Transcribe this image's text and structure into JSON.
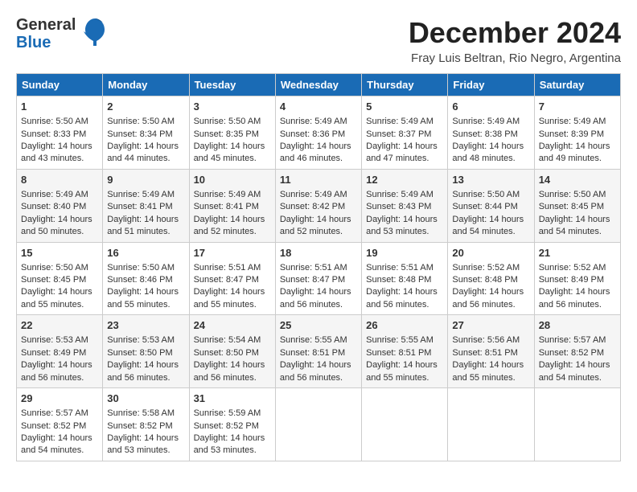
{
  "logo": {
    "line1": "General",
    "line2": "Blue"
  },
  "title": "December 2024",
  "location": "Fray Luis Beltran, Rio Negro, Argentina",
  "days_header": [
    "Sunday",
    "Monday",
    "Tuesday",
    "Wednesday",
    "Thursday",
    "Friday",
    "Saturday"
  ],
  "weeks": [
    [
      {
        "day": "1",
        "sunrise": "Sunrise: 5:50 AM",
        "sunset": "Sunset: 8:33 PM",
        "daylight": "Daylight: 14 hours and 43 minutes."
      },
      {
        "day": "2",
        "sunrise": "Sunrise: 5:50 AM",
        "sunset": "Sunset: 8:34 PM",
        "daylight": "Daylight: 14 hours and 44 minutes."
      },
      {
        "day": "3",
        "sunrise": "Sunrise: 5:50 AM",
        "sunset": "Sunset: 8:35 PM",
        "daylight": "Daylight: 14 hours and 45 minutes."
      },
      {
        "day": "4",
        "sunrise": "Sunrise: 5:49 AM",
        "sunset": "Sunset: 8:36 PM",
        "daylight": "Daylight: 14 hours and 46 minutes."
      },
      {
        "day": "5",
        "sunrise": "Sunrise: 5:49 AM",
        "sunset": "Sunset: 8:37 PM",
        "daylight": "Daylight: 14 hours and 47 minutes."
      },
      {
        "day": "6",
        "sunrise": "Sunrise: 5:49 AM",
        "sunset": "Sunset: 8:38 PM",
        "daylight": "Daylight: 14 hours and 48 minutes."
      },
      {
        "day": "7",
        "sunrise": "Sunrise: 5:49 AM",
        "sunset": "Sunset: 8:39 PM",
        "daylight": "Daylight: 14 hours and 49 minutes."
      }
    ],
    [
      {
        "day": "8",
        "sunrise": "Sunrise: 5:49 AM",
        "sunset": "Sunset: 8:40 PM",
        "daylight": "Daylight: 14 hours and 50 minutes."
      },
      {
        "day": "9",
        "sunrise": "Sunrise: 5:49 AM",
        "sunset": "Sunset: 8:41 PM",
        "daylight": "Daylight: 14 hours and 51 minutes."
      },
      {
        "day": "10",
        "sunrise": "Sunrise: 5:49 AM",
        "sunset": "Sunset: 8:41 PM",
        "daylight": "Daylight: 14 hours and 52 minutes."
      },
      {
        "day": "11",
        "sunrise": "Sunrise: 5:49 AM",
        "sunset": "Sunset: 8:42 PM",
        "daylight": "Daylight: 14 hours and 52 minutes."
      },
      {
        "day": "12",
        "sunrise": "Sunrise: 5:49 AM",
        "sunset": "Sunset: 8:43 PM",
        "daylight": "Daylight: 14 hours and 53 minutes."
      },
      {
        "day": "13",
        "sunrise": "Sunrise: 5:50 AM",
        "sunset": "Sunset: 8:44 PM",
        "daylight": "Daylight: 14 hours and 54 minutes."
      },
      {
        "day": "14",
        "sunrise": "Sunrise: 5:50 AM",
        "sunset": "Sunset: 8:45 PM",
        "daylight": "Daylight: 14 hours and 54 minutes."
      }
    ],
    [
      {
        "day": "15",
        "sunrise": "Sunrise: 5:50 AM",
        "sunset": "Sunset: 8:45 PM",
        "daylight": "Daylight: 14 hours and 55 minutes."
      },
      {
        "day": "16",
        "sunrise": "Sunrise: 5:50 AM",
        "sunset": "Sunset: 8:46 PM",
        "daylight": "Daylight: 14 hours and 55 minutes."
      },
      {
        "day": "17",
        "sunrise": "Sunrise: 5:51 AM",
        "sunset": "Sunset: 8:47 PM",
        "daylight": "Daylight: 14 hours and 55 minutes."
      },
      {
        "day": "18",
        "sunrise": "Sunrise: 5:51 AM",
        "sunset": "Sunset: 8:47 PM",
        "daylight": "Daylight: 14 hours and 56 minutes."
      },
      {
        "day": "19",
        "sunrise": "Sunrise: 5:51 AM",
        "sunset": "Sunset: 8:48 PM",
        "daylight": "Daylight: 14 hours and 56 minutes."
      },
      {
        "day": "20",
        "sunrise": "Sunrise: 5:52 AM",
        "sunset": "Sunset: 8:48 PM",
        "daylight": "Daylight: 14 hours and 56 minutes."
      },
      {
        "day": "21",
        "sunrise": "Sunrise: 5:52 AM",
        "sunset": "Sunset: 8:49 PM",
        "daylight": "Daylight: 14 hours and 56 minutes."
      }
    ],
    [
      {
        "day": "22",
        "sunrise": "Sunrise: 5:53 AM",
        "sunset": "Sunset: 8:49 PM",
        "daylight": "Daylight: 14 hours and 56 minutes."
      },
      {
        "day": "23",
        "sunrise": "Sunrise: 5:53 AM",
        "sunset": "Sunset: 8:50 PM",
        "daylight": "Daylight: 14 hours and 56 minutes."
      },
      {
        "day": "24",
        "sunrise": "Sunrise: 5:54 AM",
        "sunset": "Sunset: 8:50 PM",
        "daylight": "Daylight: 14 hours and 56 minutes."
      },
      {
        "day": "25",
        "sunrise": "Sunrise: 5:55 AM",
        "sunset": "Sunset: 8:51 PM",
        "daylight": "Daylight: 14 hours and 56 minutes."
      },
      {
        "day": "26",
        "sunrise": "Sunrise: 5:55 AM",
        "sunset": "Sunset: 8:51 PM",
        "daylight": "Daylight: 14 hours and 55 minutes."
      },
      {
        "day": "27",
        "sunrise": "Sunrise: 5:56 AM",
        "sunset": "Sunset: 8:51 PM",
        "daylight": "Daylight: 14 hours and 55 minutes."
      },
      {
        "day": "28",
        "sunrise": "Sunrise: 5:57 AM",
        "sunset": "Sunset: 8:52 PM",
        "daylight": "Daylight: 14 hours and 54 minutes."
      }
    ],
    [
      {
        "day": "29",
        "sunrise": "Sunrise: 5:57 AM",
        "sunset": "Sunset: 8:52 PM",
        "daylight": "Daylight: 14 hours and 54 minutes."
      },
      {
        "day": "30",
        "sunrise": "Sunrise: 5:58 AM",
        "sunset": "Sunset: 8:52 PM",
        "daylight": "Daylight: 14 hours and 53 minutes."
      },
      {
        "day": "31",
        "sunrise": "Sunrise: 5:59 AM",
        "sunset": "Sunset: 8:52 PM",
        "daylight": "Daylight: 14 hours and 53 minutes."
      },
      null,
      null,
      null,
      null
    ]
  ]
}
